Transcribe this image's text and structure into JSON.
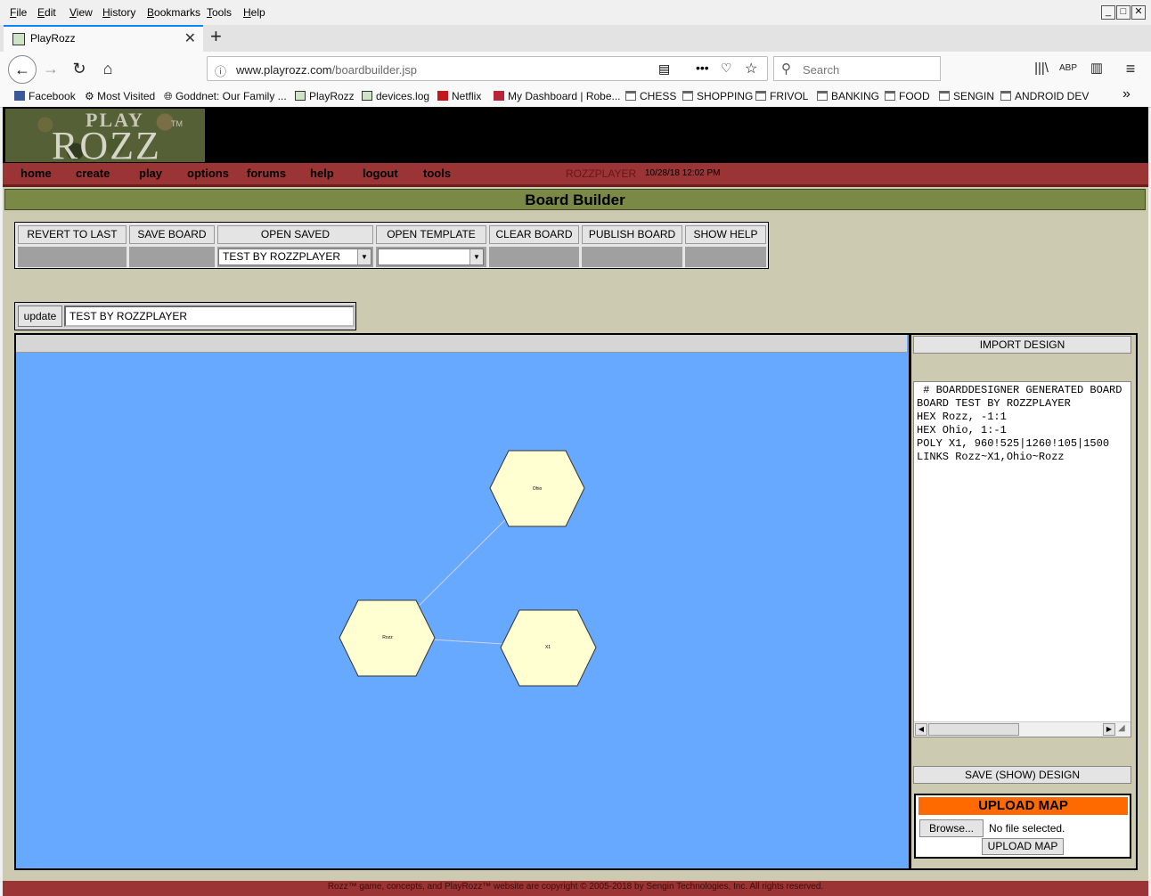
{
  "browser": {
    "menu": [
      "File",
      "Edit",
      "View",
      "History",
      "Bookmarks",
      "Tools",
      "Help"
    ],
    "tab_title": "PlayRozz",
    "url_host": "www.playrozz.com",
    "url_path": "/boardbuilder.jsp",
    "search_placeholder": "Search",
    "bookmarks": [
      "Facebook",
      "Most Visited",
      "Goddnet: Our Family ...",
      "PlayRozz",
      "devices.log",
      "Netflix",
      "My Dashboard | Robe...",
      "CHESS",
      "SHOPPING",
      "FRIVOL",
      "BANKING",
      "FOOD",
      "SENGIN",
      "ANDROID DEV"
    ]
  },
  "site": {
    "logo_play": "PLAY",
    "logo_rozz": "ROZZ",
    "logo_tm": "TM",
    "nav": [
      "home",
      "create",
      "play",
      "options",
      "forums",
      "help",
      "logout",
      "tools"
    ],
    "user": "ROZZPLAYER",
    "datetime": "10/28/18 12:02 PM",
    "page_title": "Board Builder",
    "footer": "Rozz™ game, concepts, and PlayRozz™ website are copyright © 2005-2018 by Sengin Technologies, Inc. All rights reserved."
  },
  "toolbar": {
    "revert": "REVERT TO LAST",
    "save": "SAVE BOARD",
    "open_saved": "OPEN SAVED",
    "open_template": "OPEN TEMPLATE",
    "clear": "CLEAR BOARD",
    "publish": "PUBLISH BOARD",
    "show_help": "SHOW HELP",
    "saved_selected": "TEST BY ROZZPLAYER",
    "template_selected": ""
  },
  "board_name": {
    "update_label": "update",
    "value": "TEST BY ROZZPLAYER"
  },
  "design": {
    "import_label": "IMPORT DESIGN",
    "save_show_label": "SAVE (SHOW) DESIGN",
    "text": " # BOARDDESIGNER GENERATED BOARD\nBOARD TEST BY ROZZPLAYER\nHEX Rozz, -1:1\nHEX Ohio, 1:-1\nPOLY X1, 960!525|1260!105|1500\nLINKS Rozz~X1,Ohio~Rozz"
  },
  "upload": {
    "heading": "UPLOAD MAP",
    "browse": "Browse...",
    "no_file": "No file selected.",
    "upload_button": "UPLOAD MAP"
  },
  "board": {
    "hexes": [
      {
        "name": "Ohio"
      },
      {
        "name": "Rozz"
      },
      {
        "name": "X1"
      }
    ],
    "colors": {
      "background": "#66a9ff",
      "hex_fill": "#ffffd1",
      "link": "#c8c8e6"
    }
  }
}
